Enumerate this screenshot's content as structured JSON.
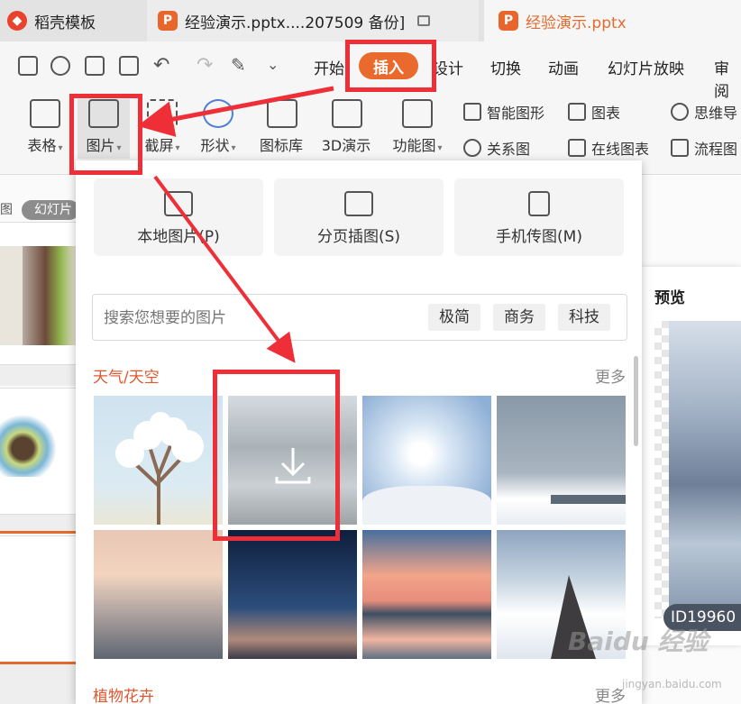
{
  "tabs": [
    {
      "label": "稻壳模板",
      "icon": "daoke-logo-icon"
    },
    {
      "label": "经验演示.pptx....207509 备份]",
      "icon": "ppt-logo-icon"
    },
    {
      "label": "经验演示.pptx",
      "icon": "ppt-logo-icon",
      "active": true
    }
  ],
  "menu": {
    "start": "开始",
    "insert": "插入",
    "design": "设计",
    "transition": "切换",
    "animation": "动画",
    "slideshow": "幻灯片放映",
    "review": "审阅"
  },
  "tools": {
    "table": "表格",
    "picture": "图片",
    "screenshot": "截屏",
    "shape": "形状",
    "iconlib": "图标库",
    "demo3d": "3D演示",
    "funcmap": "功能图",
    "smartart": "智能图形",
    "chart": "图表",
    "mindmap": "思维导",
    "relation": "关系图",
    "onlinechart": "在线图表",
    "flowchart": "流程图"
  },
  "left_panel": {
    "tab_prefix": "图",
    "slides_tab": "幻灯片"
  },
  "popup": {
    "sources": [
      "本地图片(P)",
      "分页插图(S)",
      "手机传图(M)"
    ],
    "search_placeholder": "搜索您想要的图片",
    "chips": [
      "极简",
      "商务",
      "科技"
    ],
    "section1": "天气/天空",
    "section2": "植物花卉",
    "more": "更多"
  },
  "preview": {
    "title": "预览",
    "id": "ID19960"
  },
  "watermark": {
    "main": "Baidu 经验",
    "sub": "jingyan.baidu.com"
  },
  "colors": {
    "accent": "#ea6a2e",
    "annotation": "#ef2f37"
  }
}
